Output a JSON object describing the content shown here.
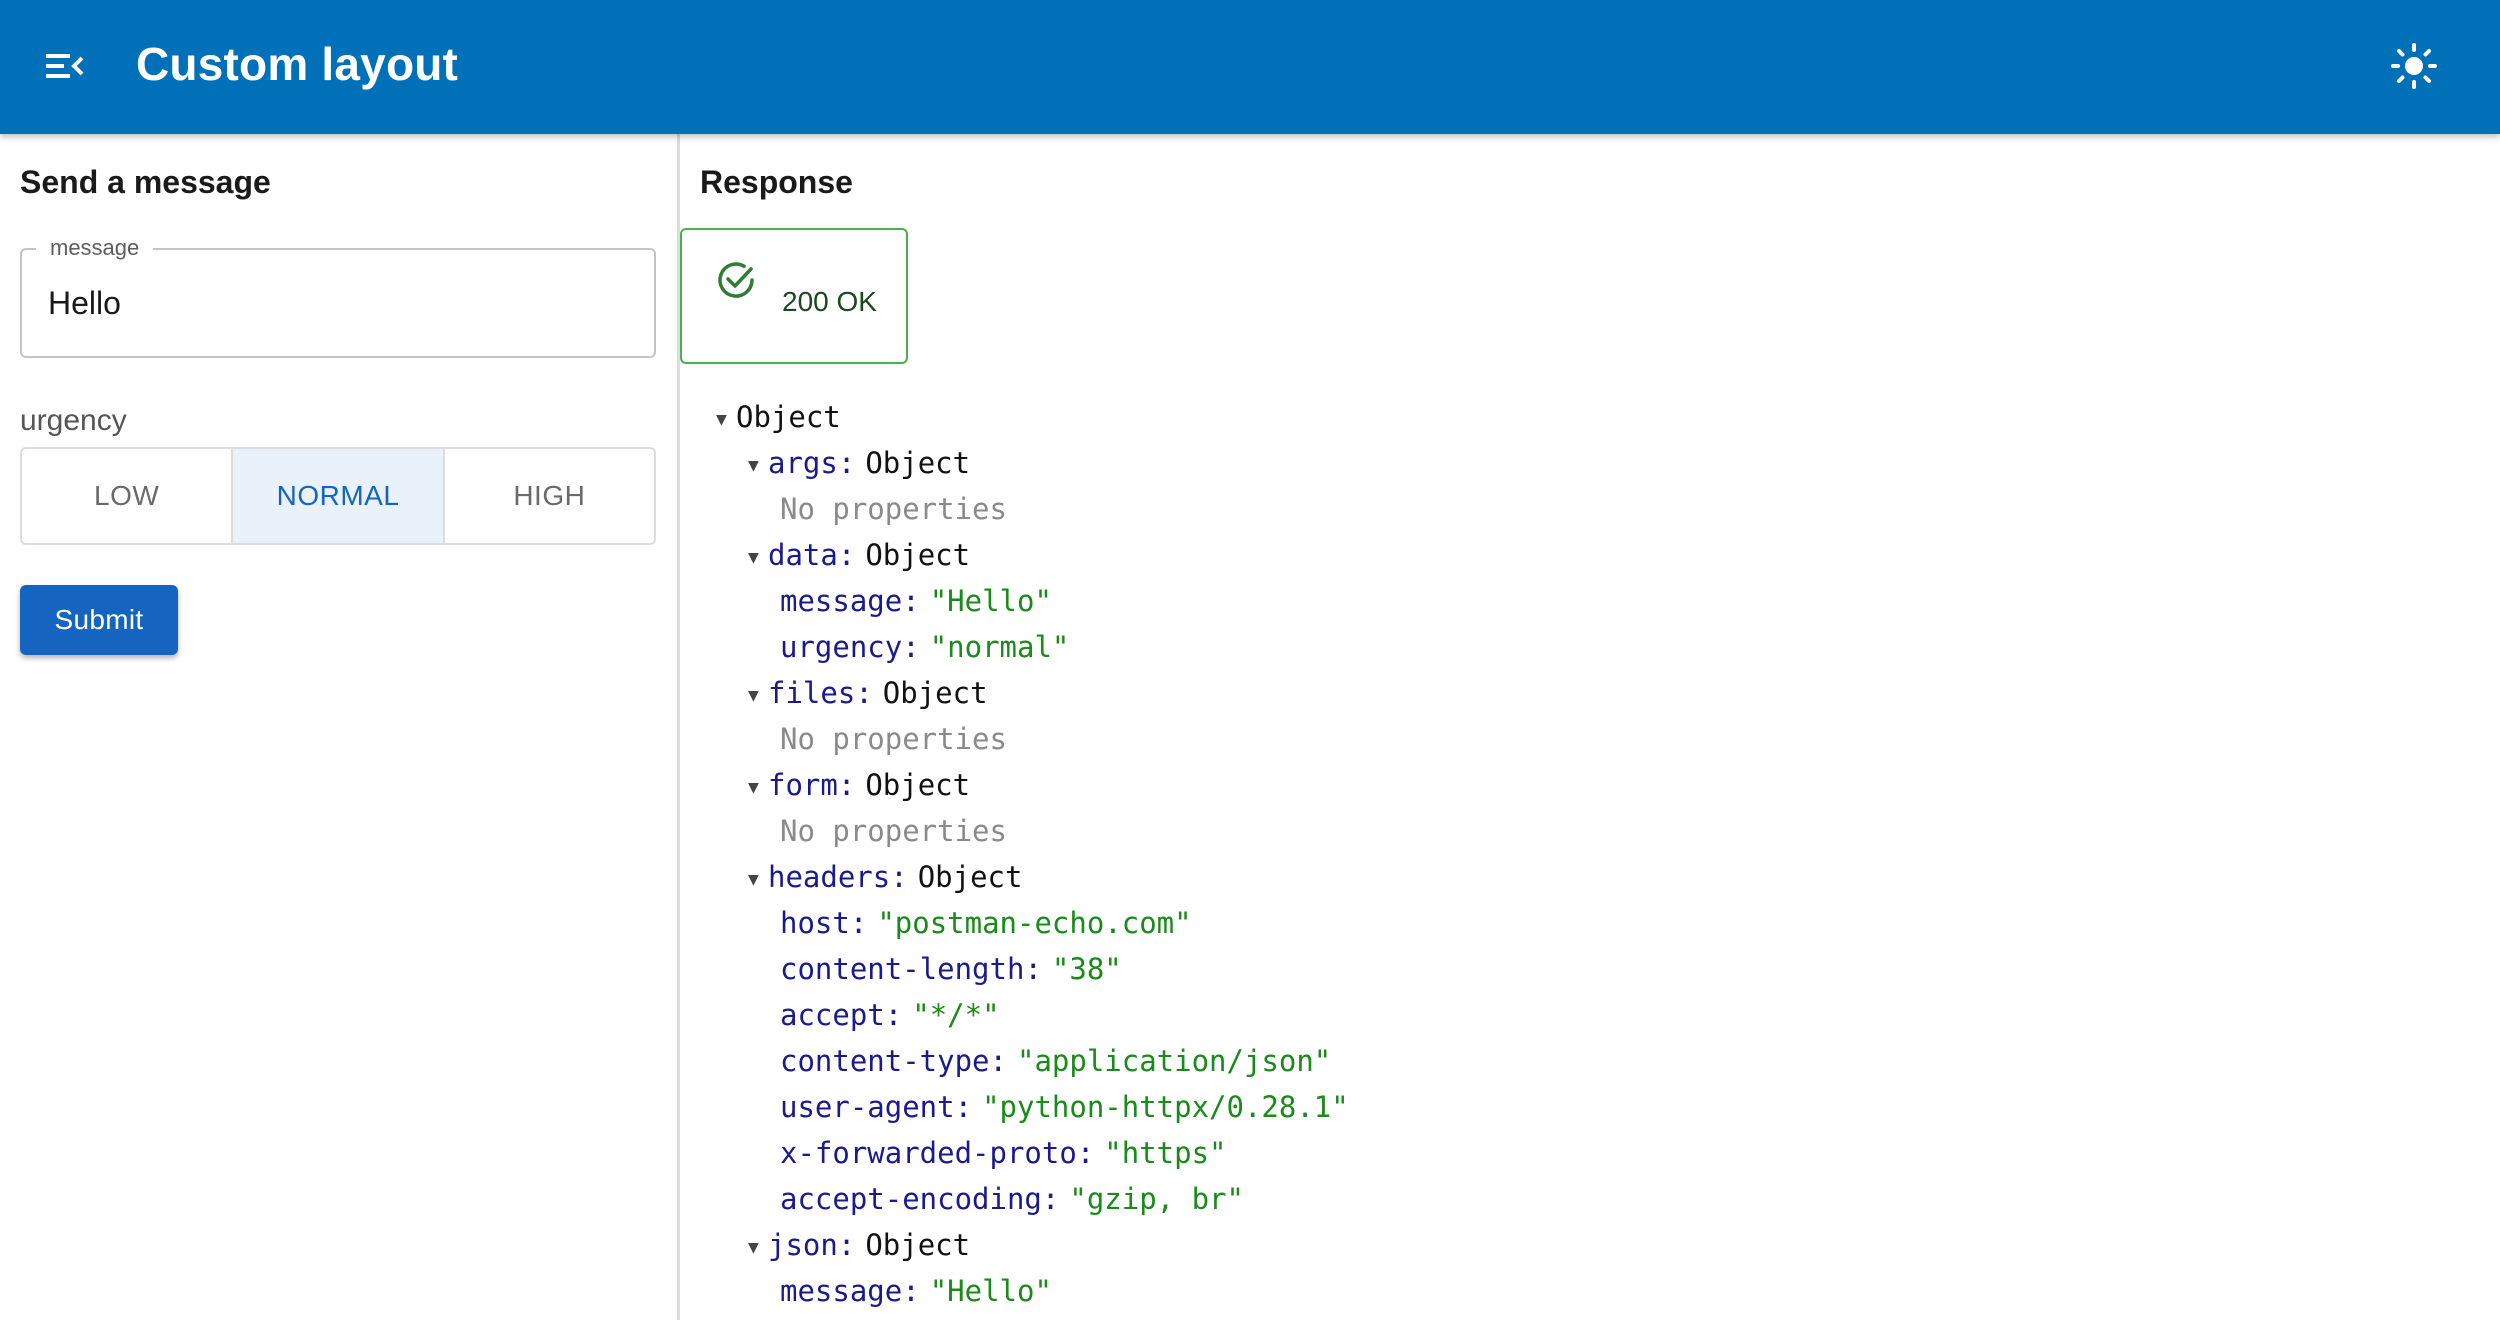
{
  "app": {
    "title": "Custom layout",
    "menu_icon": "menu-collapse-icon",
    "theme_icon": "sun-icon",
    "accent": "#0071b8"
  },
  "left": {
    "title": "Send a message",
    "message": {
      "label": "message",
      "value": "Hello"
    },
    "urgency": {
      "label": "urgency",
      "options": [
        "LOW",
        "NORMAL",
        "HIGH"
      ],
      "selected": "NORMAL"
    },
    "submit_label": "Submit"
  },
  "right": {
    "title": "Response",
    "status": {
      "text": "200 OK",
      "icon": "check-circle-icon",
      "color": "#4caf50"
    },
    "tree": {
      "root": "Object",
      "no_props": "No properties",
      "args": {
        "key": "args",
        "type": "Object"
      },
      "data": {
        "key": "data",
        "type": "Object",
        "message": {
          "key": "message",
          "value": "\"Hello\""
        },
        "urgency": {
          "key": "urgency",
          "value": "\"normal\""
        }
      },
      "files": {
        "key": "files",
        "type": "Object"
      },
      "form": {
        "key": "form",
        "type": "Object"
      },
      "headers": {
        "key": "headers",
        "type": "Object",
        "entries": [
          {
            "key": "host",
            "value": "\"postman-echo.com\""
          },
          {
            "key": "content-length",
            "value": "\"38\""
          },
          {
            "key": "accept",
            "value": "\"*/*\""
          },
          {
            "key": "content-type",
            "value": "\"application/json\""
          },
          {
            "key": "user-agent",
            "value": "\"python-httpx/0.28.1\""
          },
          {
            "key": "x-forwarded-proto",
            "value": "\"https\""
          },
          {
            "key": "accept-encoding",
            "value": "\"gzip, br\""
          }
        ]
      },
      "json": {
        "key": "json",
        "type": "Object",
        "message": {
          "key": "message",
          "value": "\"Hello\""
        }
      }
    }
  }
}
